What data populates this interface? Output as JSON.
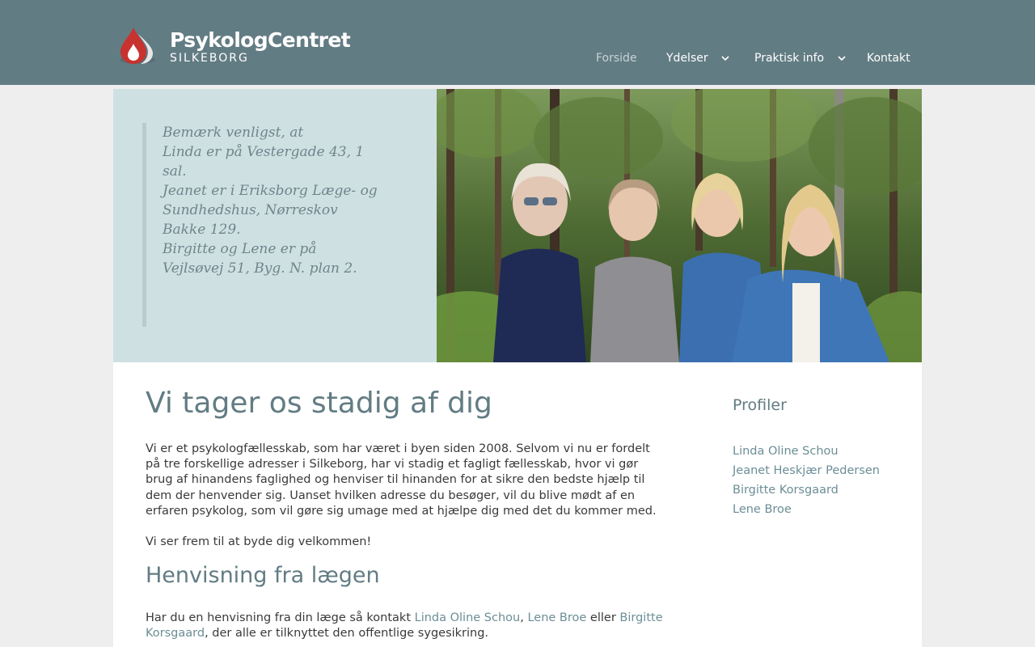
{
  "brand": {
    "name": "PsykologCentret",
    "city": "SILKEBORG",
    "colors": {
      "header": "#627c83",
      "accent_red": "#c8322f",
      "notice_bg": "#cfe0e3"
    }
  },
  "nav": {
    "items": [
      {
        "label": "Forside",
        "active": true,
        "has_dropdown": false
      },
      {
        "label": "Ydelser",
        "active": false,
        "has_dropdown": true
      },
      {
        "label": "Praktisk info",
        "active": false,
        "has_dropdown": true
      },
      {
        "label": "Kontakt",
        "active": false,
        "has_dropdown": false
      }
    ],
    "dropdown_icon": "chevron-down-icon"
  },
  "notice": {
    "lines": [
      "Bemærk venligst, at",
      "Linda er på Vestergade 43, 1",
      "sal.",
      "Jeanet er i Eriksborg Læge- og",
      "Sundhedshus, Nørreskov",
      "Bakke 129.",
      "Birgitte og Lene er på",
      "Vejlsøvej 51, Byg. N. plan 2."
    ]
  },
  "main": {
    "title": "Vi tager os stadig af dig",
    "intro": "Vi er et psykologfællesskab, som har været i byen siden 2008. Selvom vi nu er fordelt på tre forskellige adresser i Silkeborg, har vi stadig et fagligt fællesskab, hvor vi gør brug af hinandens faglighed og henviser til hinanden for at sikre den bedste hjælp til dem der henvender sig. Uanset hvilken adresse du besøger, vil du blive mødt af en erfaren psykolog, som vil gøre sig umage med at hjælpe dig med det du kommer med.",
    "welcome": "Vi ser frem til at byde dig velkommen!",
    "referral": {
      "title": "Henvisning fra lægen",
      "text_before": "Har du en henvisning fra din læge så kontakt ",
      "link1": "Linda Oline Schou",
      "sep1": ", ",
      "link2": "Lene Broe",
      "sep2": " eller ",
      "link3": "Birgitte Korsgaard",
      "text_after": ", der alle er tilknyttet den offentlige sygesikring."
    }
  },
  "sidebar": {
    "title": "Profiler",
    "profiles": [
      "Linda Oline Schou",
      "Jeanet Heskjær Pedersen",
      "Birgitte Korsgaard",
      "Lene Broe"
    ]
  }
}
